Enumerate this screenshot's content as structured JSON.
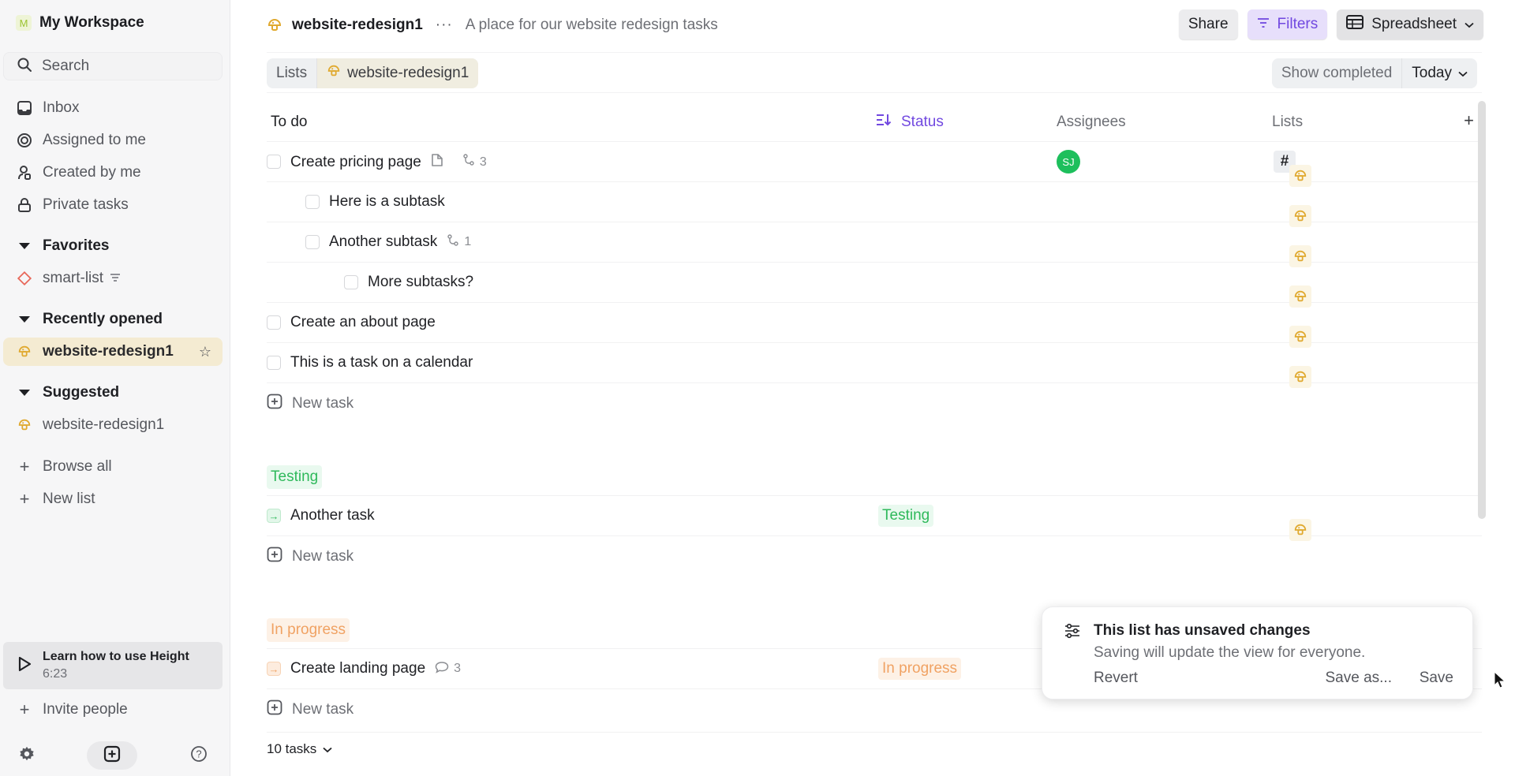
{
  "sidebar": {
    "workspace": {
      "initial": "M",
      "name": "My Workspace"
    },
    "search": {
      "placeholder": "Search"
    },
    "nav": [
      {
        "label": "Inbox",
        "icon": "inbox-icon"
      },
      {
        "label": "Assigned to me",
        "icon": "target-icon"
      },
      {
        "label": "Created by me",
        "icon": "user-created-icon"
      },
      {
        "label": "Private tasks",
        "icon": "lock-icon"
      }
    ],
    "favorites": {
      "title": "Favorites",
      "items": [
        {
          "label": "smart-list",
          "icon": "diamond-icon",
          "has_filter": true
        }
      ]
    },
    "recent": {
      "title": "Recently opened",
      "items": [
        {
          "label": "website-redesign1",
          "icon": "mushroom-icon",
          "active": true
        }
      ]
    },
    "suggested": {
      "title": "Suggested",
      "items": [
        {
          "label": "website-redesign1",
          "icon": "mushroom-icon"
        }
      ]
    },
    "browse_all": "Browse all",
    "new_list": "New list",
    "learn": {
      "title": "Learn how to use Height",
      "duration": "6:23"
    },
    "invite": "Invite people"
  },
  "header": {
    "list_name": "website-redesign1",
    "description": "A place for our website redesign tasks",
    "more": "···",
    "share": "Share",
    "filters": "Filters",
    "view": "Spreadsheet"
  },
  "breadcrumbs": [
    "Lists",
    "website-redesign1"
  ],
  "toolbar": {
    "show_completed": "Show completed",
    "date": "Today"
  },
  "columns": {
    "todo": "To do",
    "status": "Status",
    "assignees": "Assignees",
    "lists": "Lists",
    "add": "+"
  },
  "groups": {
    "todo": {
      "tasks": [
        {
          "name": "Create pricing page",
          "has_doc": true,
          "subtasks": "3",
          "assignee": "SJ",
          "lists": [
            "hash",
            "mushroom"
          ]
        },
        {
          "name": "Here is a subtask",
          "lists": [
            "mushroom"
          ]
        },
        {
          "name": "Another subtask",
          "subtasks": "1",
          "lists": [
            "mushroom"
          ]
        },
        {
          "name": "More subtasks?",
          "lists": [
            "mushroom"
          ]
        },
        {
          "name": "Create an about page",
          "lists": [
            "mushroom"
          ]
        },
        {
          "name": "This is a task on a calendar",
          "lists": [
            "mushroom"
          ]
        }
      ]
    },
    "testing": {
      "label": "Testing",
      "tasks": [
        {
          "name": "Another task",
          "status": "Testing",
          "lists": [
            "mushroom"
          ]
        }
      ]
    },
    "progress": {
      "label": "In progress",
      "tasks": [
        {
          "name": "Create landing page",
          "comments": "3",
          "status": "In progress"
        }
      ]
    }
  },
  "new_task": "New task",
  "footer": {
    "count": "10 tasks"
  },
  "toast": {
    "title": "This list has unsaved changes",
    "subtitle": "Saving will update the view for everyone.",
    "revert": "Revert",
    "save_as": "Save as...",
    "save": "Save"
  },
  "colors": {
    "accent": "#7148e0",
    "testing": "#2fb95b",
    "in_progress": "#f0a263",
    "assignee": "#1dbf5c",
    "list_icon": "#e0a92f"
  }
}
